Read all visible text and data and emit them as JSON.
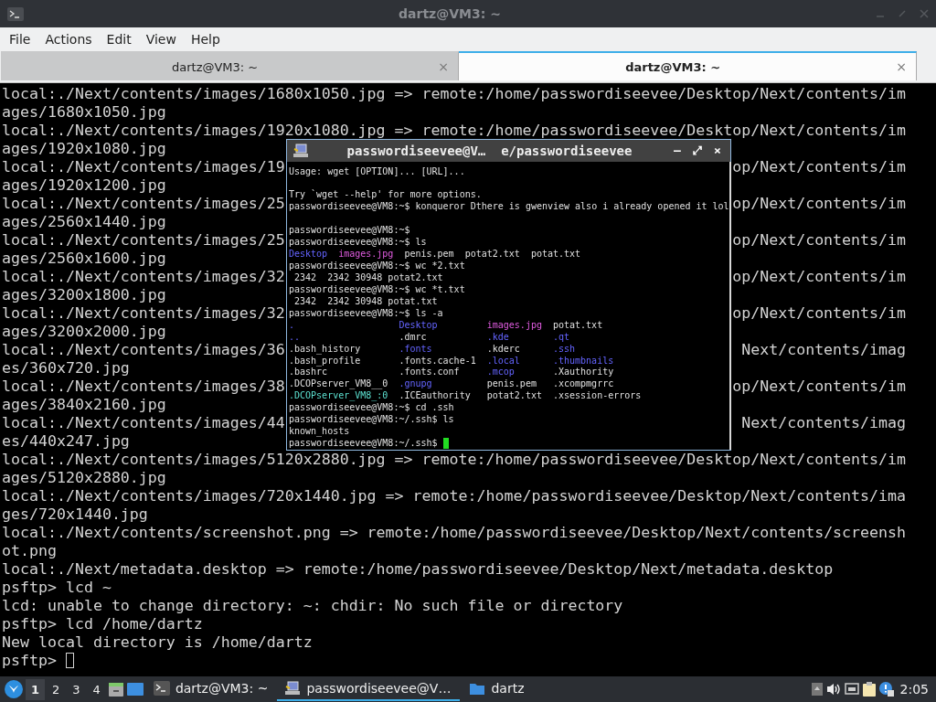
{
  "window": {
    "title": "dartz@VM3: ~"
  },
  "menu": [
    "File",
    "Actions",
    "Edit",
    "View",
    "Help"
  ],
  "tabs": [
    {
      "label": "dartz@VM3: ~",
      "selected": false,
      "close": "×"
    },
    {
      "label": "dartz@VM3: ~",
      "selected": true,
      "close": "×"
    }
  ],
  "terminal": {
    "lines": [
      {
        "text": "local:./Next/contents/images/1680x1050.jpg => remote:/home/passwordiseevee/Desktop/Next/contents/im"
      },
      {
        "text": "ages/1680x1050.jpg"
      },
      {
        "text": "local:./Next/contents/images/1920x1080.jpg => remote:/home/passwordiseevee/Desktop/Next/contents/im"
      },
      {
        "text": "ages/1920x1080.jpg"
      },
      {
        "text": "local:./Next/contents/images/19",
        "right": "op/Next/contents/im"
      },
      {
        "text": "ages/1920x1200.jpg"
      },
      {
        "text": "local:./Next/contents/images/25",
        "right": "op/Next/contents/im"
      },
      {
        "text": "ages/2560x1440.jpg"
      },
      {
        "text": "local:./Next/contents/images/25",
        "right": "op/Next/contents/im"
      },
      {
        "text": "ages/2560x1600.jpg"
      },
      {
        "text": "local:./Next/contents/images/32",
        "right": "op/Next/contents/im"
      },
      {
        "text": "ages/3200x1800.jpg"
      },
      {
        "text": "local:./Next/contents/images/32",
        "right": "op/Next/contents/im"
      },
      {
        "text": "ages/3200x2000.jpg"
      },
      {
        "text": "local:./Next/contents/images/36",
        "right": "Next/contents/imag"
      },
      {
        "text": "es/360x720.jpg"
      },
      {
        "text": "local:./Next/contents/images/38",
        "right": "op/Next/contents/im"
      },
      {
        "text": "ages/3840x2160.jpg"
      },
      {
        "text": "local:./Next/contents/images/44",
        "right": "Next/contents/imag"
      },
      {
        "text": "es/440x247.jpg"
      },
      {
        "text": "local:./Next/contents/images/5120x2880.jpg => remote:/home/passwordiseevee/Desktop/Next/contents/im"
      },
      {
        "text": "ages/5120x2880.jpg"
      },
      {
        "text": "local:./Next/contents/images/720x1440.jpg => remote:/home/passwordiseevee/Desktop/Next/contents/ima"
      },
      {
        "text": "ges/720x1440.jpg"
      },
      {
        "text": "local:./Next/contents/screenshot.png => remote:/home/passwordiseevee/Desktop/Next/contents/screensh"
      },
      {
        "text": "ot.png"
      },
      {
        "text": "local:./Next/metadata.desktop => remote:/home/passwordiseevee/Desktop/Next/metadata.desktop"
      },
      {
        "text": "psftp> lcd ~"
      },
      {
        "text": "lcd: unable to change directory: ~: chdir: No such file or directory"
      },
      {
        "text": "psftp> lcd /home/dartz"
      },
      {
        "text": "New local directory is /home/dartz"
      },
      {
        "text": "psftp> ",
        "cursor": true
      }
    ]
  },
  "inner_window": {
    "title": "passwordiseevee@V…  e/passwordiseevee",
    "buttons": [
      "–",
      "⤢",
      "×"
    ],
    "lines": [
      {
        "kind": "text",
        "text": "Usage: wget [OPTION]... [URL]..."
      },
      {
        "kind": "blank"
      },
      {
        "kind": "text",
        "text": "Try `wget --help' for more options."
      },
      {
        "kind": "text",
        "text": "passwordiseevee@VM8:~$ konqueror Dthere is gwenview also i already opened it lol"
      },
      {
        "kind": "blank"
      },
      {
        "kind": "text",
        "text": "passwordiseevee@VM8:~$"
      },
      {
        "kind": "text",
        "text": "passwordiseevee@VM8:~$ ls"
      },
      {
        "kind": "ls",
        "cells": [
          {
            "text": "Desktop",
            "kind": "dir"
          },
          {
            "text": "images.jpg",
            "kind": "image"
          },
          {
            "text": "penis.pem",
            "kind": "file"
          },
          {
            "text": "potat2.txt",
            "kind": "file"
          },
          {
            "text": "potat.txt",
            "kind": "file"
          }
        ]
      },
      {
        "kind": "text",
        "text": "passwordiseevee@VM8:~$ wc *2.txt"
      },
      {
        "kind": "text",
        "text": " 2342  2342 30948 potat2.txt"
      },
      {
        "kind": "text",
        "text": "passwordiseevee@VM8:~$ wc *t.txt"
      },
      {
        "kind": "text",
        "text": " 2342  2342 30948 potat.txt"
      },
      {
        "kind": "text",
        "text": "passwordiseevee@VM8:~$ ls -a"
      },
      {
        "kind": "grid",
        "cells": [
          {
            "text": ".",
            "kind": "dir"
          },
          {
            "text": "Desktop",
            "kind": "dir"
          },
          {
            "text": "images.jpg",
            "kind": "image"
          },
          {
            "text": "potat.txt",
            "kind": "file"
          }
        ]
      },
      {
        "kind": "grid",
        "cells": [
          {
            "text": "..",
            "kind": "dir"
          },
          {
            "text": ".dmrc",
            "kind": "file"
          },
          {
            "text": ".kde",
            "kind": "dir"
          },
          {
            "text": ".qt",
            "kind": "dir"
          }
        ]
      },
      {
        "kind": "grid",
        "cells": [
          {
            "text": ".bash_history",
            "kind": "file"
          },
          {
            "text": ".fonts",
            "kind": "dir"
          },
          {
            "text": ".kderc",
            "kind": "file"
          },
          {
            "text": ".ssh",
            "kind": "dir"
          }
        ]
      },
      {
        "kind": "grid",
        "cells": [
          {
            "text": ".bash_profile",
            "kind": "file"
          },
          {
            "text": ".fonts.cache-1",
            "kind": "file"
          },
          {
            "text": ".local",
            "kind": "dir"
          },
          {
            "text": ".thumbnails",
            "kind": "dir"
          }
        ]
      },
      {
        "kind": "grid",
        "cells": [
          {
            "text": ".bashrc",
            "kind": "file"
          },
          {
            "text": ".fonts.conf",
            "kind": "file"
          },
          {
            "text": ".mcop",
            "kind": "dir"
          },
          {
            "text": ".Xauthority",
            "kind": "file"
          }
        ]
      },
      {
        "kind": "grid",
        "cells": [
          {
            "text": ".DCOPserver_VM8__0",
            "kind": "file"
          },
          {
            "text": ".gnupg",
            "kind": "dir"
          },
          {
            "text": "penis.pem",
            "kind": "file"
          },
          {
            "text": ".xcompmgrrc",
            "kind": "file"
          }
        ]
      },
      {
        "kind": "grid",
        "cells": [
          {
            "text": ".DCOPserver_VM8_:0",
            "kind": "socket"
          },
          {
            "text": ".ICEauthority",
            "kind": "file"
          },
          {
            "text": "potat2.txt",
            "kind": "file"
          },
          {
            "text": ".xsession-errors",
            "kind": "file"
          }
        ]
      },
      {
        "kind": "text",
        "text": "passwordiseevee@VM8:~$ cd .ssh"
      },
      {
        "kind": "text",
        "text": "passwordiseevee@VM8:~/.ssh$ ls"
      },
      {
        "kind": "text",
        "text": "known_hosts"
      },
      {
        "kind": "text",
        "text": "passwordiseevee@VM8:~/.ssh$ ",
        "cursor": true
      }
    ]
  },
  "taskbar": {
    "workspaces": [
      {
        "label": "1",
        "selected": true
      },
      {
        "label": "2",
        "selected": false
      },
      {
        "label": "3",
        "selected": false
      },
      {
        "label": "4",
        "selected": false
      }
    ],
    "tasks": [
      {
        "kind": "terminal",
        "label": "dartz@VM3: ~",
        "selected": false
      },
      {
        "kind": "remote",
        "label": "passwordiseevee@V…",
        "selected": true
      },
      {
        "kind": "folder",
        "label": "dartz",
        "selected": false
      }
    ],
    "clock": "2:05"
  }
}
